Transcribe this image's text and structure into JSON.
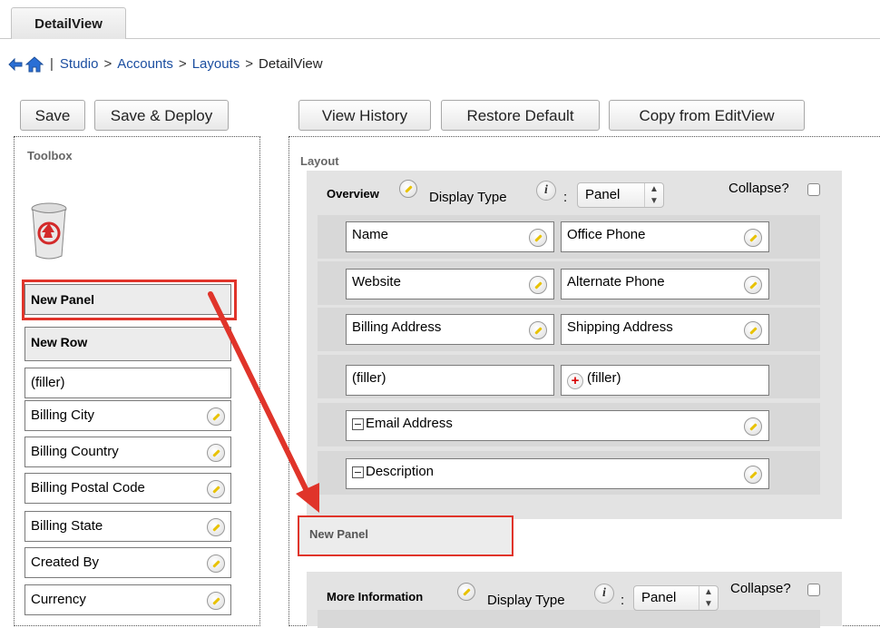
{
  "tab": {
    "label": "DetailView"
  },
  "breadcrumb": {
    "sep": "|",
    "items": [
      "Studio",
      "Accounts",
      "Layouts"
    ],
    "current": "DetailView",
    "divider": ">"
  },
  "toolbar_left": {
    "save": "Save",
    "save_deploy": "Save & Deploy"
  },
  "toolbar_right": {
    "view_history": "View History",
    "restore_default": "Restore Default",
    "copy_from": "Copy from EditView"
  },
  "toolbox": {
    "title": "Toolbox",
    "new_panel": "New Panel",
    "new_row": "New Row",
    "filler": "(filler)",
    "fields": [
      "Billing City",
      "Billing Country",
      "Billing Postal Code",
      "Billing State",
      "Created By",
      "Currency"
    ]
  },
  "layout": {
    "title": "Layout",
    "panel1": {
      "name": "Overview",
      "display_type_label": "Display Type",
      "colon": ":",
      "display_type": "Panel",
      "collapse_label": "Collapse?",
      "rows": [
        [
          "Name",
          "Office Phone"
        ],
        [
          "Website",
          "Alternate Phone"
        ],
        [
          "Billing Address",
          "Shipping Address"
        ],
        [
          "(filler)",
          "(filler)"
        ]
      ],
      "wide_rows": [
        "Email Address",
        "Description"
      ]
    },
    "new_panel_drop": "New Panel",
    "panel2": {
      "name": "More Information",
      "display_type_label": "Display Type",
      "colon": ":",
      "display_type": "Panel",
      "collapse_label": "Collapse?"
    }
  },
  "colors": {
    "highlight": "#e0342a",
    "link": "#1b4ea0"
  }
}
